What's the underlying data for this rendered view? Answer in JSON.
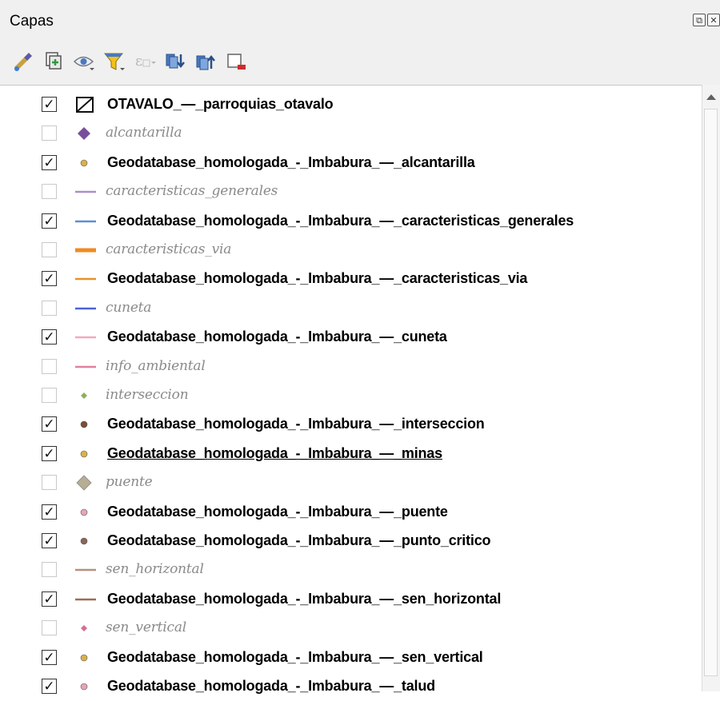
{
  "panel": {
    "title": "Capas"
  },
  "window_controls": {
    "float": "⧉",
    "close": "✕"
  },
  "toolbar": {
    "items": [
      "style-manager-icon",
      "add-group-icon",
      "visibility-icon",
      "filter-icon",
      "filter-expression-icon",
      "expand-all-icon",
      "collapse-all-icon",
      "remove-layer-icon"
    ]
  },
  "layers": [
    {
      "name": "OTAVALO_—_parroquias_otavalo",
      "checked": true,
      "symbol": "polygon-hatch"
    },
    {
      "name": "alcantarilla",
      "checked": false,
      "symbol": "diamond",
      "color": "#7a4f9a"
    },
    {
      "name": "Geodatabase_homologada_-_Imbabura_—_alcantarilla",
      "checked": true,
      "symbol": "point",
      "color": "#d9b24a"
    },
    {
      "name": "caracteristicas_generales",
      "checked": false,
      "symbol": "line",
      "color": "#a98fc7"
    },
    {
      "name": "Geodatabase_homologada_-_Imbabura_—_caracteristicas_generales",
      "checked": true,
      "symbol": "line",
      "color": "#5b8fd1"
    },
    {
      "name": "caracteristicas_via",
      "checked": false,
      "symbol": "line-thick",
      "color": "#f08a24"
    },
    {
      "name": "Geodatabase_homologada_-_Imbabura_—_caracteristicas_via",
      "checked": true,
      "symbol": "line",
      "color": "#e8912b"
    },
    {
      "name": "cuneta",
      "checked": false,
      "symbol": "line",
      "color": "#4a63d6"
    },
    {
      "name": "Geodatabase_homologada_-_Imbabura_—_cuneta",
      "checked": true,
      "symbol": "line",
      "color": "#f1a9bf"
    },
    {
      "name": "info_ambiental",
      "checked": false,
      "symbol": "line",
      "color": "#e2809c"
    },
    {
      "name": "interseccion",
      "checked": false,
      "symbol": "diamond-small",
      "color": "#8fb05a"
    },
    {
      "name": "Geodatabase_homologada_-_Imbabura_—_interseccion",
      "checked": true,
      "symbol": "point",
      "color": "#7b4e34"
    },
    {
      "name": "Geodatabase_homologada_-_Imbabura_—_minas",
      "checked": true,
      "symbol": "point",
      "color": "#d9b24a",
      "underline": true
    },
    {
      "name": "puente",
      "checked": false,
      "symbol": "diamond-large",
      "color": "#b7ad93"
    },
    {
      "name": "Geodatabase_homologada_-_Imbabura_—_puente",
      "checked": true,
      "symbol": "point",
      "color": "#e6a5b5"
    },
    {
      "name": "Geodatabase_homologada_-_Imbabura_—_punto_critico",
      "checked": true,
      "symbol": "point",
      "color": "#8a6658"
    },
    {
      "name": "sen_horizontal",
      "checked": false,
      "symbol": "line",
      "color": "#b88f7b"
    },
    {
      "name": "Geodatabase_homologada_-_Imbabura_—_sen_horizontal",
      "checked": true,
      "symbol": "line",
      "color": "#9b6d58"
    },
    {
      "name": "sen_vertical",
      "checked": false,
      "symbol": "diamond-small",
      "color": "#d66f8f"
    },
    {
      "name": "Geodatabase_homologada_-_Imbabura_—_sen_vertical",
      "checked": true,
      "symbol": "point",
      "color": "#d9b24a"
    },
    {
      "name": "Geodatabase_homologada_-_Imbabura_—_talud",
      "checked": true,
      "symbol": "point",
      "color": "#e6a5b5"
    }
  ]
}
